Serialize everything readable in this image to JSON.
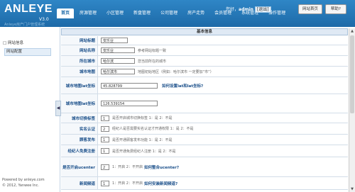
{
  "header": {
    "logo": "ANLEYE",
    "version": "V3.0",
    "subtitle": "Anleye房产门户管理系统",
    "nav": [
      "首页",
      "房源管理",
      "小区管理",
      "新盘管理",
      "公司管理",
      "房产走势",
      "会员管理",
      "系统管理",
      "操作管理"
    ],
    "user_prefix": "您好，",
    "username": "admin",
    "logout": "[退出]",
    "site_home": "网站首页",
    "help": "帮助?"
  },
  "sidebar": {
    "section": "网站信息",
    "item": "网站配置",
    "powered": "Powered by anleye.com",
    "copyright": "© 2012, Yanwee Inc."
  },
  "panel": {
    "title": "基本信息",
    "rows": [
      {
        "label": "网站标题",
        "value": "安乐业",
        "hint": ""
      },
      {
        "label": "网站名称",
        "value": "安乐业",
        "hint": "参考网站标题一致"
      },
      {
        "label": "所在城市",
        "value": "哈尔滨",
        "hint": "您当前所在的城市"
      },
      {
        "label": "城市地图",
        "value": "哈尔滨市",
        "hint": "地图初始地区（例如：哈尔滨市 一定要加“市”）"
      },
      {
        "label": "城市地图lat坐标",
        "value": "45.828799",
        "hint": "",
        "link": "如何设置lat和lat坐标?"
      },
      {
        "label": "城市地图lat坐标",
        "value": "126.539154",
        "hint": ""
      },
      {
        "label": "城市切换标签",
        "value": "1",
        "hint": "是否开启城市切换标签 1：是 2：不是"
      },
      {
        "label": "实名认证",
        "value": "2",
        "hint": "经纪人是否需要实名认证才开通权限 1：是 2：不是"
      },
      {
        "label": "顾客发布",
        "value": "1",
        "hint": "是否开通顾客发布功能 1：是 2：不是"
      },
      {
        "label": "经纪人免费注册",
        "value": "1",
        "hint": "是否开通免费经纪人注册 1：是 2：不是"
      },
      {
        "label": "是否开启ucenter",
        "value": "2",
        "hint": "1：开启 2：不开启",
        "link": "如何整合ucenter?"
      },
      {
        "label": "新闻频道",
        "value": "1",
        "hint": "1：开启 2：不开启",
        "link": "如何安装新闻频道?"
      }
    ]
  },
  "colors": {
    "topbar": "#1d6aa8",
    "label": "#1a4f8a"
  }
}
